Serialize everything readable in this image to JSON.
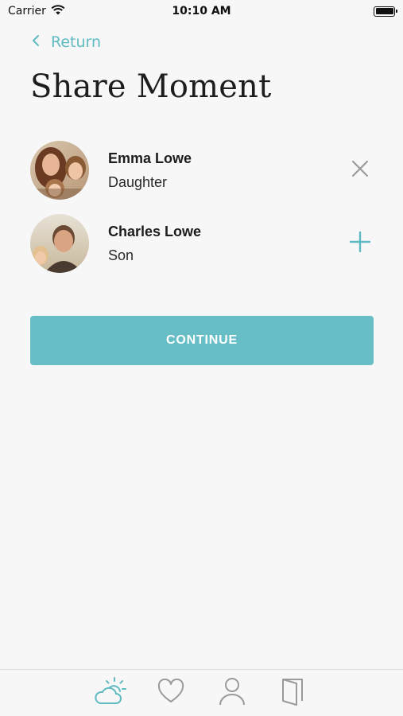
{
  "status_bar": {
    "carrier": "Carrier",
    "time": "10:10 AM"
  },
  "nav": {
    "return_label": "Return"
  },
  "page": {
    "title": "Share Moment"
  },
  "contacts": [
    {
      "name": "Emma Lowe",
      "relation": "Daughter",
      "action": "close-icon",
      "selected": true
    },
    {
      "name": "Charles Lowe",
      "relation": "Son",
      "action": "plus-icon",
      "selected": false
    }
  ],
  "continue_label": "CONTINUE",
  "tab_bar": {
    "tabs": [
      {
        "icon": "weather-icon",
        "active": true
      },
      {
        "icon": "heart-icon",
        "active": false
      },
      {
        "icon": "person-icon",
        "active": false
      },
      {
        "icon": "door-icon",
        "active": false
      }
    ]
  },
  "colors": {
    "accent": "#5fbac2",
    "button": "#68bec6",
    "background": "#f7f7f7",
    "icon_inactive": "#9a9a9a"
  }
}
